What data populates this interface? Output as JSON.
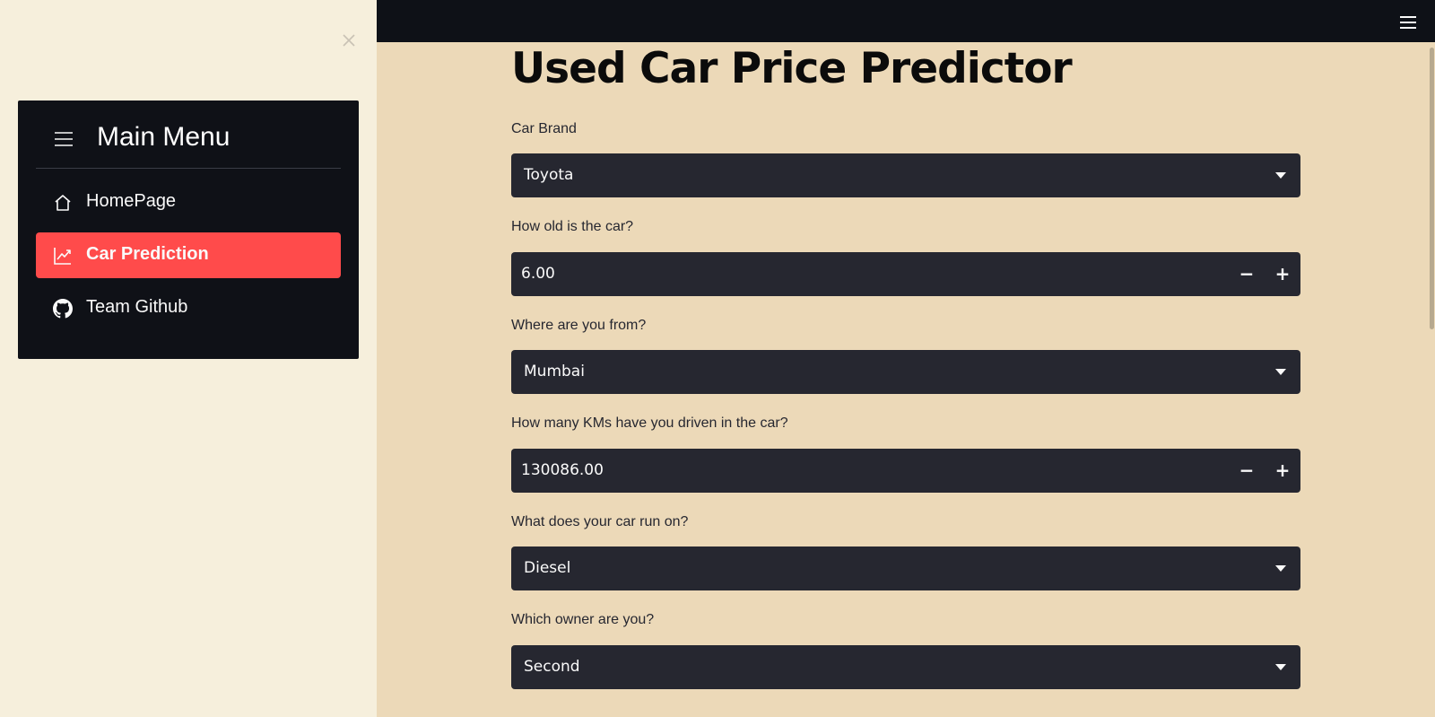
{
  "sidebar": {
    "close_icon": "x-icon",
    "menu_title": "Main Menu",
    "menu_icon": "menu-lines-icon",
    "items": [
      {
        "label": "HomePage",
        "icon": "house-icon",
        "active": false
      },
      {
        "label": "Car Prediction",
        "icon": "graph-up-icon",
        "active": true
      },
      {
        "label": "Team Github",
        "icon": "github-icon",
        "active": false
      }
    ]
  },
  "header": {
    "menu_icon": "hamburger-icon"
  },
  "main": {
    "title": "Used Car Price Predictor",
    "fields": {
      "brand": {
        "label": "Car Brand",
        "value": "Toyota"
      },
      "age": {
        "label": "How old is the car?",
        "value": "6.00"
      },
      "location": {
        "label": "Where are you from?",
        "value": "Mumbai"
      },
      "kms": {
        "label": "How many KMs have you driven in the car?",
        "value": "130086.00"
      },
      "fuel": {
        "label": "What does your car run on?",
        "value": "Diesel"
      },
      "owner": {
        "label": "Which owner are you?",
        "value": "Second"
      }
    }
  },
  "colors": {
    "accent": "#ff4b4b",
    "sidebar_bg": "#f6efdc",
    "main_bg": "#ecd9b8",
    "control_bg": "#262730",
    "menu_bg": "#0f1117"
  }
}
